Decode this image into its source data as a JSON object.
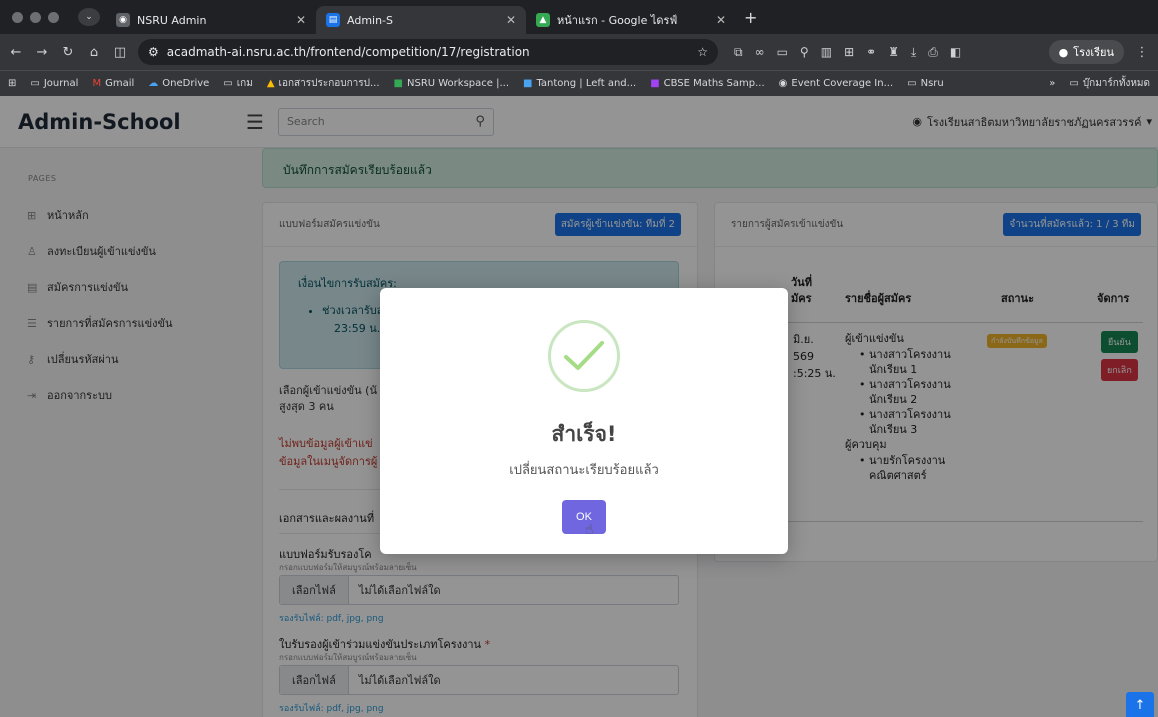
{
  "browser": {
    "tabs": [
      {
        "title": "NSRU Admin",
        "active": false
      },
      {
        "title": "Admin-S",
        "active": true
      },
      {
        "title": "หน้าแรก - Google ไดรฟ์",
        "active": false
      }
    ],
    "url": "acadmath-ai.nsru.ac.th/frontend/competition/17/registration",
    "profile_label": "โรงเรียน",
    "bookmarks": [
      "Journal",
      "Gmail",
      "OneDrive",
      "เกม",
      "เอกสารประกอบการป...",
      "NSRU Workspace |...",
      "Tantong | Left and...",
      "CBSE Maths Samp...",
      "Event Coverage In...",
      "Nsru",
      "บุ๊กมาร์กทั้งหมด"
    ]
  },
  "header": {
    "brand": "Admin-School",
    "search_placeholder": "Search",
    "user": "โรงเรียนสาธิตมหาวิทยาลัยราชภัฏนครสวรรค์"
  },
  "sidebar": {
    "section_label": "PAGES",
    "items": [
      {
        "label": "หน้าหลัก",
        "icon": "grid-icon"
      },
      {
        "label": "ลงทะเบียนผู้เข้าแข่งขัน",
        "icon": "user-icon"
      },
      {
        "label": "สมัครการแข่งขัน",
        "icon": "file-icon"
      },
      {
        "label": "รายการที่สมัครการแข่งขัน",
        "icon": "list-icon"
      },
      {
        "label": "เปลี่ยนรหัสผ่าน",
        "icon": "key-icon"
      },
      {
        "label": "ออกจากระบบ",
        "icon": "logout-icon"
      }
    ]
  },
  "main": {
    "success_alert": "บันทึกการสมัครเรียบร้อยแล้ว",
    "left_card": {
      "title": "แบบฟอร์มสมัครแข่งขัน",
      "badge": "สมัครผู้เข้าแข่งขัน: ทีมที่ 2",
      "conditions_title": "เงื่อนไขการรับสมัคร:",
      "condition_item_1": "ช่วงเวลารับส",
      "condition_item_2": "23:59 น.",
      "select_label_1": "เลือกผู้เข้าแข่งขัน (นั",
      "select_label_2": "สูงสุด 3 คน",
      "warning_1": "ไม่พบข้อมูลผู้เข้าแข่",
      "warning_2": "ข้อมูลในเมนูจัดการผู้",
      "docs_title": "เอกสารและผลงานที่",
      "form1_title": "แบบฟอร์มรับรองโค",
      "form1_sub": "กรอกแบบฟอร์มให้สมบูรณ์พร้อมลายเซ็น",
      "file_button": "เลือกไฟล์",
      "no_file": "ไม่ได้เลือกไฟล์ใด",
      "file_hint": "รองรับไฟล์: pdf, jpg, png",
      "form2_title": "ใบรับรองผู้เข้าร่วมแข่งขันประเภทโครงงาน",
      "form2_required": "*",
      "form2_sub": "กรอกแบบฟอร์มให้สมบูรณ์พร้อมลายเซ็น",
      "file_hint_2": "รองรับไฟล์: pdf, jpg, png"
    },
    "right_card": {
      "title": "รายการผู้สมัครเข้าแข่งขัน",
      "badge": "จำนวนที่สมัครแล้ว: 1 / 3 ทีม",
      "columns": {
        "date_1": "วันที่",
        "date_2": "มัคร",
        "names": "รายชื่อผู้สมัคร",
        "status": "สถานะ",
        "manage": "จัดการ"
      },
      "row": {
        "date_1": "มิ.ย.",
        "date_2": "569",
        "date_3": ":5:25 น.",
        "competitors_label": "ผู้เข้าแข่งขัน",
        "competitors": [
          "นางสาวโครงงาน",
          "นักเรียน 1",
          "นางสาวโครงงาน",
          "นักเรียน 2",
          "นางสาวโครงงาน",
          "นักเรียน 3"
        ],
        "advisor_label": "ผู้ควบคุม",
        "advisor_1": "นายรักโครงงาน",
        "advisor_2": "คณิตศาสตร์",
        "status": "กำลังบันทึกข้อมูล",
        "confirm_button": "ยืนยัน",
        "cancel_button": "ยกเลิก"
      }
    }
  },
  "modal": {
    "title": "สำเร็จ!",
    "message": "เปลี่ยนสถานะเรียบร้อยแล้ว",
    "ok_button": "OK"
  },
  "colors": {
    "accent": "#1a73e8",
    "confirm": "#7066e0",
    "success_bg": "#d4ede2",
    "warning_text": "#c0392b"
  }
}
